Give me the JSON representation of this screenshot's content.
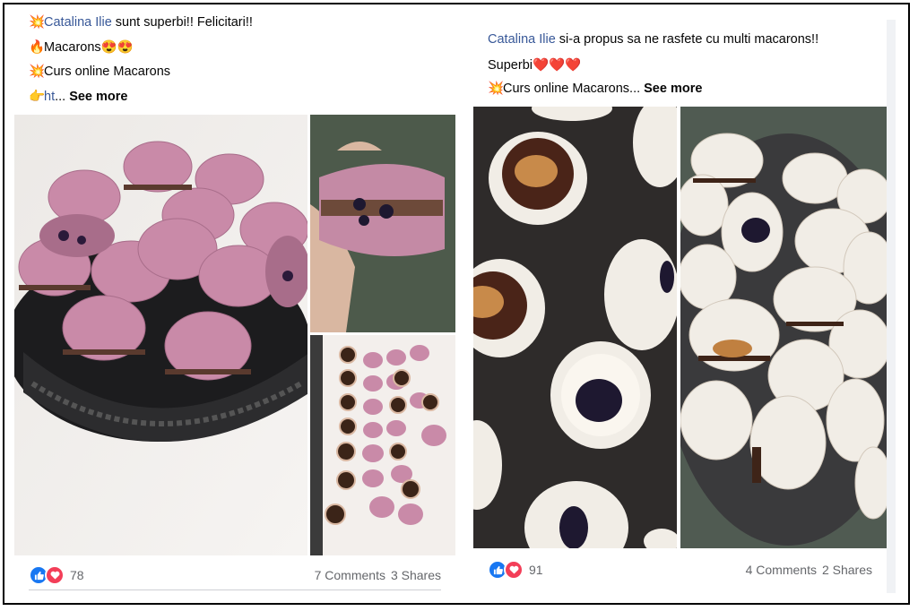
{
  "left_post": {
    "lines": [
      {
        "emoji": "💥",
        "link": "Catalina Ilie",
        "text": " sunt superbi!! Felicitari!!"
      },
      {
        "emoji": "🔥",
        "link": "",
        "text": "Macarons😍😍"
      },
      {
        "emoji": "💥",
        "link": "",
        "text": "Curs online Macarons"
      }
    ],
    "truncated": {
      "emoji": "👉",
      "link": "ht",
      "ellipsis": "...",
      "see_more": "See more"
    },
    "reactions_count": "78",
    "comments": "7 Comments",
    "shares": "3 Shares"
  },
  "right_post": {
    "line1": {
      "link": "Catalina Ilie",
      "text": " si-a propus sa ne rasfete cu multi macarons!!"
    },
    "line2": {
      "text": "Superbi",
      "hearts": "❤️❤️❤️"
    },
    "line3": {
      "emoji": "💥",
      "text": "Curs online Macarons...",
      "see_more": "See more"
    },
    "reactions_count": "91",
    "comments": "4 Comments",
    "shares": "2 Shares"
  },
  "colors": {
    "link": "#385898",
    "like": "#1877f2",
    "love": "#f33e58",
    "macaron_pink": "#c98aa8",
    "macaron_white": "#f1ede6"
  },
  "icons": [
    "collision-emoji",
    "fire-emoji",
    "pointing-hand-emoji",
    "like-icon",
    "love-icon"
  ]
}
